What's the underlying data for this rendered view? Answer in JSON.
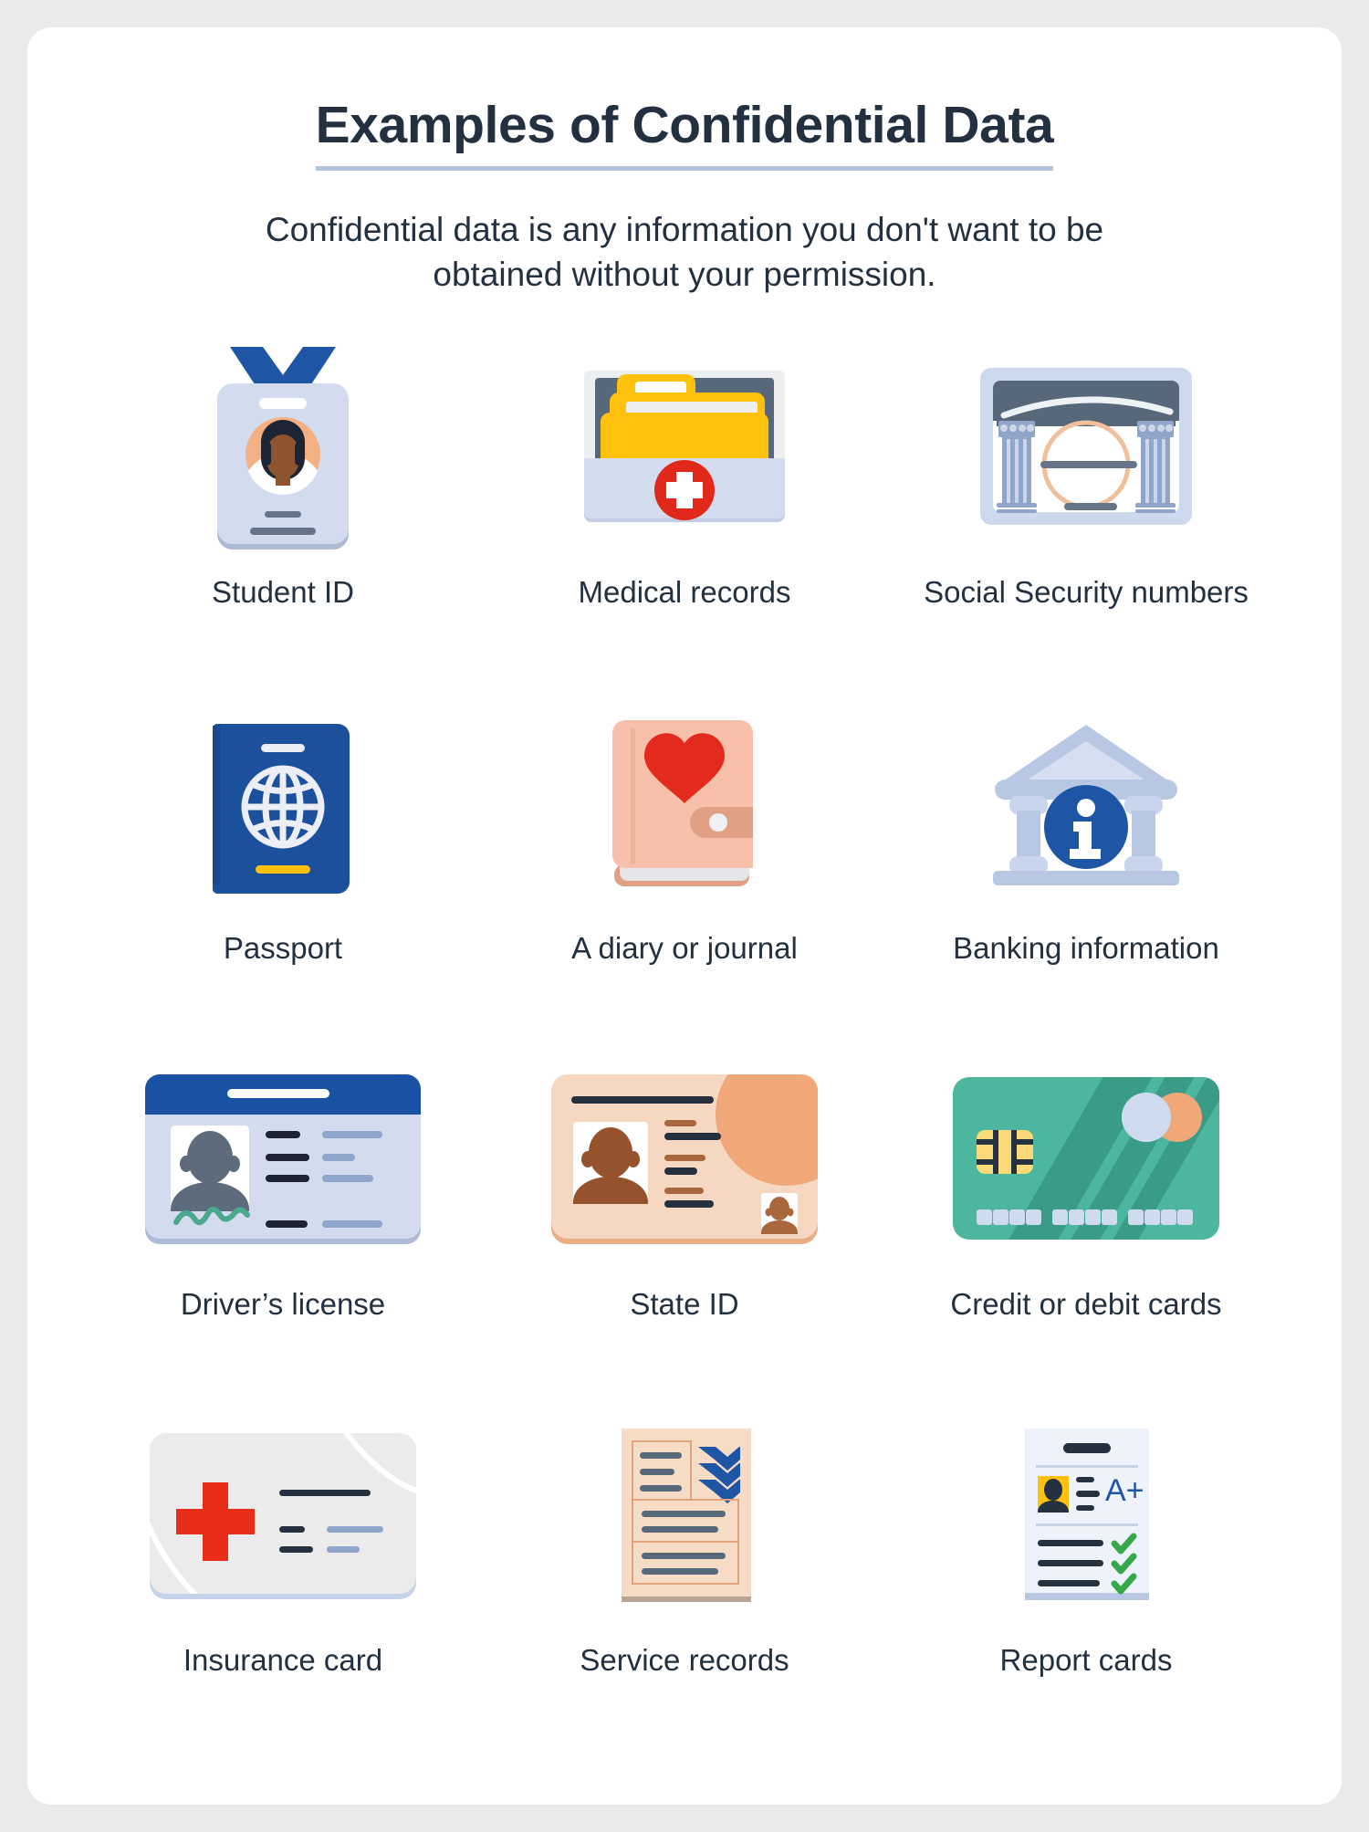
{
  "page": {
    "background_color": "#eaeaea",
    "card_color": "#ffffff"
  },
  "header": {
    "title": "Examples of Confidential Data",
    "underline_color": "#b4c4e0",
    "subtitle": "Confidential data is any information you don't want to be obtained without your permission.",
    "text_color": "#22303f"
  },
  "items": [
    {
      "label": "Student ID",
      "icon": "student-id-badge-icon",
      "colors": {
        "lanyard": "#1f55a5",
        "card": "#d3dcef",
        "card_shadow": "#aebbd6",
        "avatar_bg": "#f3b183",
        "skin": "#8e5430",
        "hair": "#1d2433"
      }
    },
    {
      "label": "Medical records",
      "icon": "medical-records-folder-icon",
      "colors": {
        "back": "#566879",
        "folder": "#fdc10e",
        "front": "#d3dcef",
        "cross_circle": "#e0291b",
        "cross": "#ffffff"
      }
    },
    {
      "label": "Social Security numbers",
      "icon": "social-security-card-icon",
      "colors": {
        "border": "#cdd9ef",
        "header": "#566879",
        "column": "#8fa5c9",
        "circle": "#f0bf9c",
        "bar": "#66748a"
      }
    },
    {
      "label": "Passport",
      "icon": "passport-icon",
      "colors": {
        "cover": "#1f55a5",
        "globe": "#ebeef5",
        "bottom_bar": "#fdc10e"
      }
    },
    {
      "label": "A diary or journal",
      "icon": "diary-journal-icon",
      "colors": {
        "cover": "#f8c0ab",
        "clasp": "#e0a084",
        "heart": "#e0291b",
        "pages": "#e4e6ea"
      }
    },
    {
      "label": "Banking information",
      "icon": "bank-building-icon",
      "colors": {
        "building": "#b8c8e4",
        "pediment": "#d5dff1",
        "info_circle": "#1f55a5",
        "info_letter": "#ffffff"
      }
    },
    {
      "label": "Driver’s license",
      "icon": "drivers-license-icon",
      "colors": {
        "header": "#1f55a5",
        "body": "#d3dcef",
        "photo_bg": "#ffffff",
        "silhouette": "#5d6b7c",
        "dark_line": "#1d2433",
        "light_line": "#8fa5c9",
        "signature": "#4aa98c",
        "shadow": "#aebbd6"
      }
    },
    {
      "label": "State ID",
      "icon": "state-id-icon",
      "colors": {
        "body": "#f6d7c2",
        "accent_circle": "#f0a878",
        "photo_bg": "#ffffff",
        "silhouette": "#96522c",
        "dark_line": "#26313f",
        "brown_line": "#a8673c",
        "edge": "#e8ad85"
      }
    },
    {
      "label": "Credit or debit cards",
      "icon": "credit-card-icon",
      "colors": {
        "body": "#4cb79e",
        "stripe": "#3a9c86",
        "chip": "#fbd978",
        "chip_line": "#26313f",
        "circle_blue": "#cfdbef",
        "circle_orange": "#f0a878",
        "number_block": "#cfdbef"
      }
    },
    {
      "label": "Insurance card",
      "icon": "insurance-card-icon",
      "colors": {
        "body": "#ebebeb",
        "swoosh": "#ffffff",
        "cross": "#e82d18",
        "dark_line": "#26313f",
        "blue_line": "#8fa5c9",
        "edge": "#c6d2e8"
      }
    },
    {
      "label": "Service records",
      "icon": "service-records-icon",
      "colors": {
        "paper": "#f6dbc5",
        "outline": "#e0a37c",
        "line": "#566879",
        "chevron": "#1f55a5",
        "base_shadow": "#b8a493"
      }
    },
    {
      "label": "Report cards",
      "icon": "report-card-icon",
      "colors": {
        "paper": "#eef2fb",
        "title_bar": "#26313f",
        "divider": "#c6d2e8",
        "photo_bg": "#fdc10e",
        "silhouette": "#26313f",
        "grade_text": "#1f55a5",
        "check": "#37a84a",
        "base": "#b8c8e4"
      }
    }
  ],
  "grade_label": "A+"
}
